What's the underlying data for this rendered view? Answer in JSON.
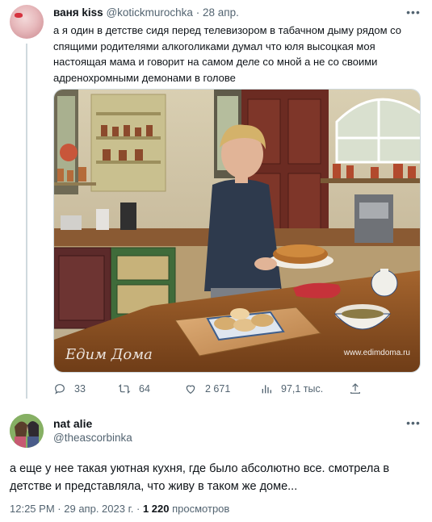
{
  "tweet1": {
    "display_name": "ваня kiss",
    "handle": "@kotickmurochka",
    "separator": "·",
    "date": "28 апр.",
    "text": "а я один в детстве сидя перед телевизором в табачном дыму рядом со спящими родителями алкоголиками думал что юля высоцкая моя настоящая мама и говорит на самом деле со мной а не со своими адренохромными демонами в голове",
    "media": {
      "watermark_logo": "Едим Дома",
      "watermark_url": "www.edimdoma.ru"
    },
    "actions": {
      "replies": "33",
      "retweets": "64",
      "likes": "2 671",
      "views": "97,1 тыс."
    },
    "icons": [
      "reply-icon",
      "retweet-icon",
      "like-icon",
      "views-icon",
      "share-icon",
      "more-icon"
    ]
  },
  "tweet2": {
    "display_name": "nat alie",
    "handle": "@theascorbinka",
    "text": "а еще у нее такая уютная кухня, где было абсолютно все. смотрела в детстве и представляла, что живу в таком же доме...",
    "time": "12:25 PM",
    "dot": "·",
    "date": "29 апр. 2023 г.",
    "dot2": "·",
    "views_count": "1 220",
    "views_label": "просмотров"
  },
  "colors": {
    "text_primary": "#0f1419",
    "text_secondary": "#536471",
    "border": "#cfd9de"
  }
}
